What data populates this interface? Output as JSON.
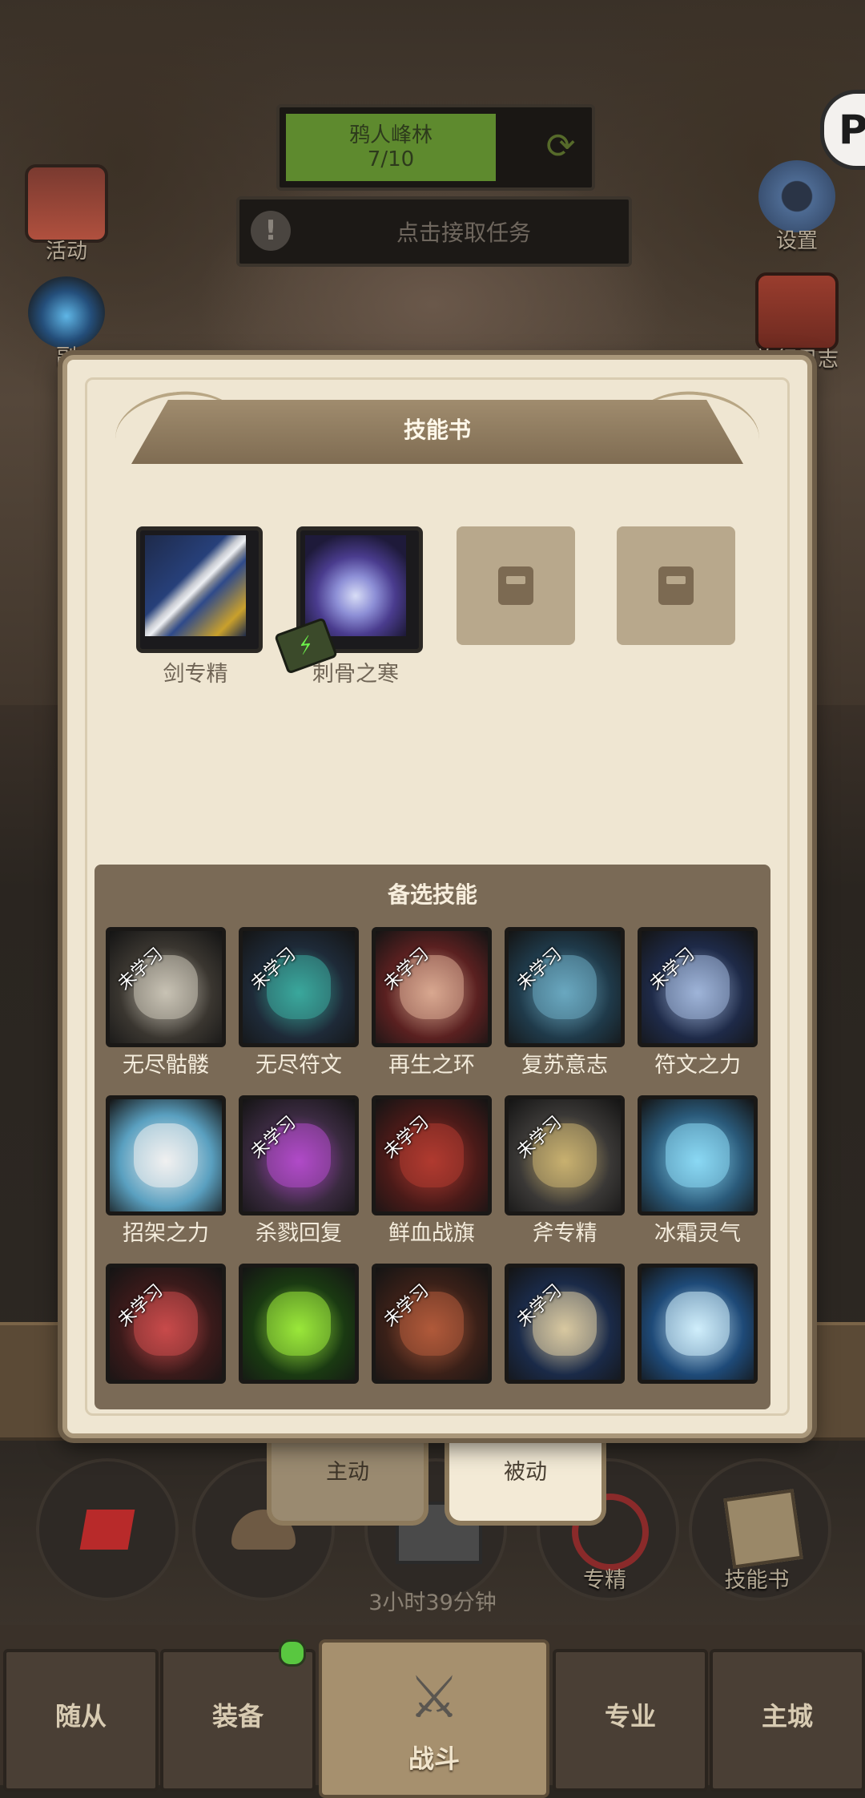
{
  "zone": {
    "name": "鸦人峰林",
    "progress": "7/10"
  },
  "quest": {
    "text": "点击接取任务"
  },
  "side_left": [
    {
      "label": "活动",
      "icon": "activity-icon"
    },
    {
      "label": "副",
      "icon": "dungeon-icon"
    }
  ],
  "side_right": [
    {
      "label": "设置",
      "icon": "gear-icon"
    },
    {
      "label": "旅行日志",
      "icon": "journal-icon"
    }
  ],
  "dialog": {
    "title": "技能书",
    "equipped": [
      {
        "name": "剑专精",
        "state": "equipped"
      },
      {
        "name": "刺骨之寒",
        "state": "equipped"
      },
      {
        "name": "",
        "state": "locked"
      },
      {
        "name": "",
        "state": "locked"
      }
    ],
    "alt_title": "备选技能",
    "unlearned_tag": "未学习",
    "skills": [
      {
        "name": "无尽骷髅",
        "unlearned": true,
        "color": "#3a3630",
        "accent": "#c8c2b4"
      },
      {
        "name": "无尽符文",
        "unlearned": true,
        "color": "#1e2a38",
        "accent": "#3aa89c"
      },
      {
        "name": "再生之环",
        "unlearned": true,
        "color": "#5a2020",
        "accent": "#d8a890"
      },
      {
        "name": "复苏意志",
        "unlearned": true,
        "color": "#1f3a4a",
        "accent": "#6aa8c0"
      },
      {
        "name": "符文之力",
        "unlearned": true,
        "color": "#1e2a48",
        "accent": "#9fb4d8"
      },
      {
        "name": "招架之力",
        "unlearned": false,
        "color": "#5aa0c0",
        "accent": "#f0f0f0"
      },
      {
        "name": "杀戮回复",
        "unlearned": true,
        "color": "#3a2a40",
        "accent": "#b04ac8"
      },
      {
        "name": "鲜血战旗",
        "unlearned": true,
        "color": "#4a1a18",
        "accent": "#b03a30"
      },
      {
        "name": "斧专精",
        "unlearned": true,
        "color": "#3a3836",
        "accent": "#c8b070"
      },
      {
        "name": "冰霜灵气",
        "unlearned": false,
        "color": "#2a5a7a",
        "accent": "#8ad8f4"
      },
      {
        "name": "",
        "unlearned": true,
        "color": "#3a1a1a",
        "accent": "#c84a4a"
      },
      {
        "name": "",
        "unlearned": false,
        "color": "#1a3a12",
        "accent": "#9ae83a"
      },
      {
        "name": "",
        "unlearned": true,
        "color": "#3a2018",
        "accent": "#b05a3a"
      },
      {
        "name": "",
        "unlearned": true,
        "color": "#1a2a48",
        "accent": "#d8c8a0"
      },
      {
        "name": "",
        "unlearned": false,
        "color": "#1e4a78",
        "accent": "#d0eefc"
      }
    ]
  },
  "tabs": [
    {
      "label": "主动",
      "active": false
    },
    {
      "label": "被动",
      "active": true
    }
  ],
  "quick": [
    {
      "label": "",
      "icon": "potion-icon"
    },
    {
      "label": "",
      "icon": "bread-icon"
    },
    {
      "label": "",
      "icon": "chest-icon"
    },
    {
      "label": "专精",
      "icon": "specialization-icon"
    },
    {
      "label": "技能书",
      "icon": "skillbook-icon"
    }
  ],
  "timer": "3小时39分钟",
  "corner_icon": "P",
  "nav": [
    {
      "label": "随从"
    },
    {
      "label": "装备"
    },
    {
      "label": "战斗"
    },
    {
      "label": "专业"
    },
    {
      "label": "主城"
    }
  ]
}
